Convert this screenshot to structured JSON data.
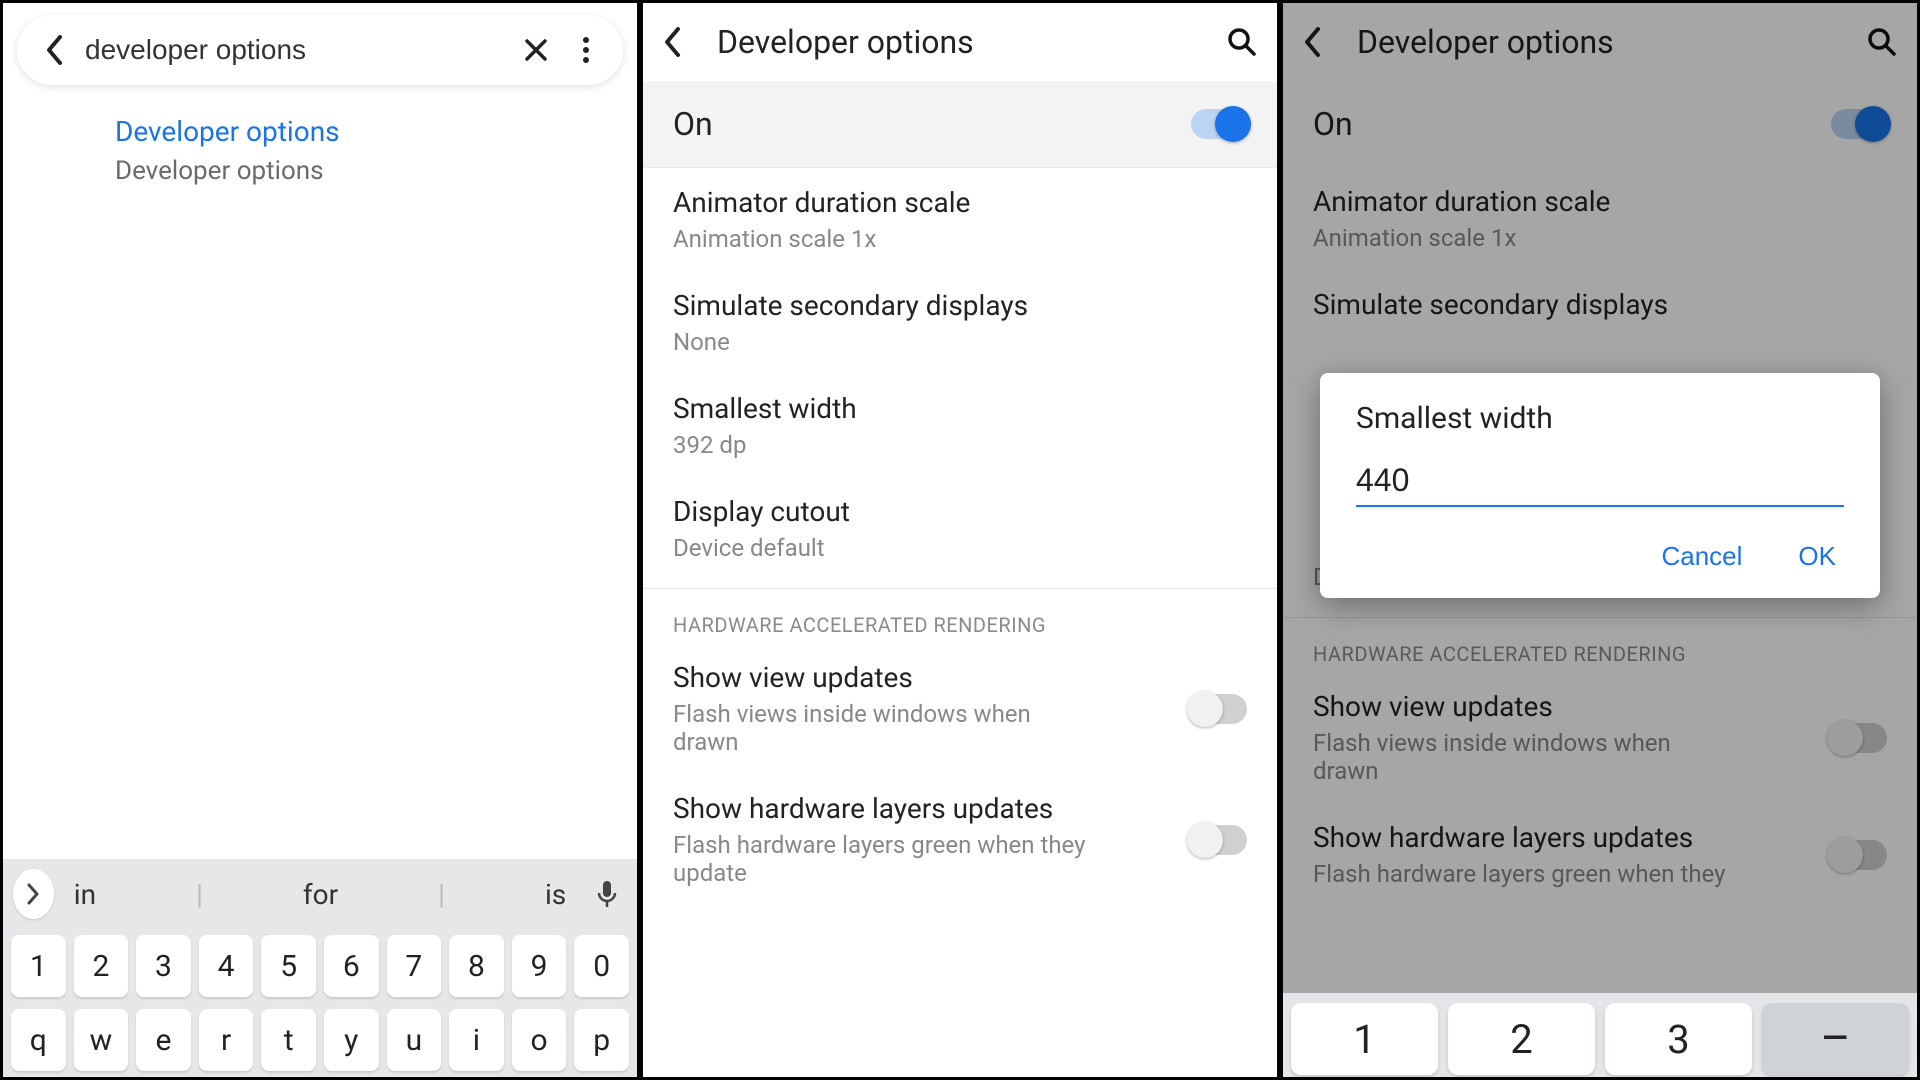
{
  "panel1": {
    "search_value": "developer options",
    "result_title": "Developer options",
    "result_sub": "Developer options",
    "suggestions": [
      "in",
      "for",
      "is"
    ],
    "keys_row1": [
      "1",
      "2",
      "3",
      "4",
      "5",
      "6",
      "7",
      "8",
      "9",
      "0"
    ],
    "keys_row2": [
      "q",
      "w",
      "e",
      "r",
      "t",
      "y",
      "u",
      "i",
      "o",
      "p"
    ]
  },
  "panel2": {
    "title": "Developer options",
    "toggle_label": "On",
    "items": [
      {
        "t": "Animator duration scale",
        "s": "Animation scale 1x"
      },
      {
        "t": "Simulate secondary displays",
        "s": "None"
      },
      {
        "t": "Smallest width",
        "s": "392 dp"
      },
      {
        "t": "Display cutout",
        "s": "Device default"
      }
    ],
    "section": "HARDWARE ACCELERATED RENDERING",
    "rows": [
      {
        "t": "Show view updates",
        "s": "Flash views inside windows when drawn"
      },
      {
        "t": "Show hardware layers updates",
        "s": "Flash hardware layers green when they update"
      }
    ]
  },
  "panel3": {
    "title": "Developer options",
    "toggle_label": "On",
    "items": [
      {
        "t": "Animator duration scale",
        "s": "Animation scale 1x"
      },
      {
        "t": "Simulate secondary displays",
        "s": ""
      },
      {
        "t": "",
        "s": ""
      },
      {
        "t": "",
        "s": "Device default"
      }
    ],
    "section": "HARDWARE ACCELERATED RENDERING",
    "rows": [
      {
        "t": "Show view updates",
        "s": "Flash views inside windows when drawn"
      },
      {
        "t": "Show hardware layers updates",
        "s": "Flash hardware layers green when they"
      }
    ],
    "dialog": {
      "title": "Smallest width",
      "value": "440",
      "cancel": "Cancel",
      "ok": "OK"
    },
    "numeric_keys": [
      "1",
      "2",
      "3",
      "–"
    ]
  }
}
